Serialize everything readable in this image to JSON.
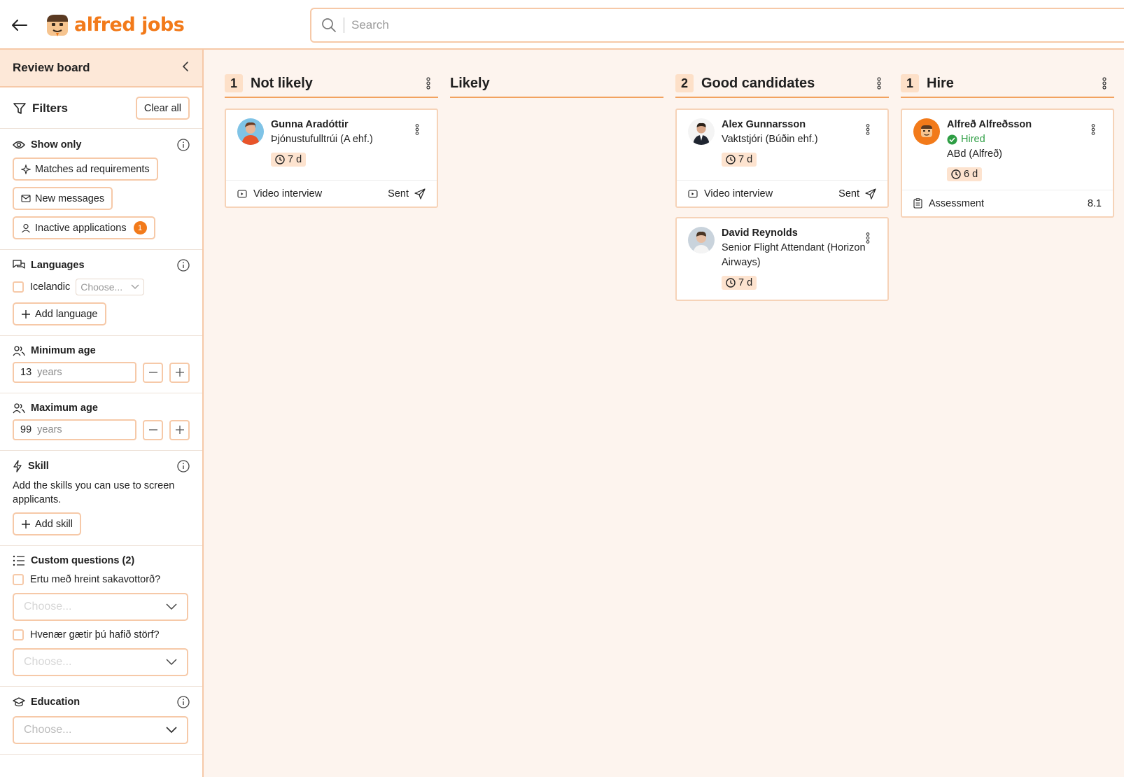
{
  "topbar": {
    "brand": "alfred jobs",
    "search_placeholder": "Search"
  },
  "sidebar": {
    "title": "Review board",
    "filters_label": "Filters",
    "clear_all": "Clear all",
    "show_only": {
      "title": "Show only",
      "chips": [
        {
          "label": "Matches ad requirements"
        },
        {
          "label": "New messages"
        },
        {
          "label": "Inactive applications",
          "badge": "1"
        }
      ]
    },
    "languages": {
      "title": "Languages",
      "items": [
        {
          "label": "Icelandic",
          "select_placeholder": "Choose..."
        }
      ],
      "add_label": "Add language"
    },
    "min_age": {
      "title": "Minimum age",
      "value": "13",
      "unit": "years"
    },
    "max_age": {
      "title": "Maximum age",
      "value": "99",
      "unit": "years"
    },
    "skill": {
      "title": "Skill",
      "help": "Add the skills you can use to screen applicants.",
      "add_label": "Add skill"
    },
    "custom_questions": {
      "title": "Custom questions (2)",
      "items": [
        {
          "question": "Ertu með hreint sakavottorð?",
          "placeholder": "Choose..."
        },
        {
          "question": "Hvenær gætir þú hafið störf?",
          "placeholder": "Choose..."
        }
      ]
    },
    "education": {
      "title": "Education",
      "placeholder": "Choose..."
    }
  },
  "board": {
    "columns": [
      {
        "count": "1",
        "title": "Not likely",
        "cards": [
          {
            "name": "Gunna Aradóttir",
            "role": "Þjónustufulltrúi (A ehf.)",
            "time": "7 d",
            "footer_left": "Video interview",
            "footer_right": "Sent"
          }
        ]
      },
      {
        "count": "",
        "title": "Likely",
        "cards": []
      },
      {
        "count": "2",
        "title": "Good candidates",
        "cards": [
          {
            "name": "Alex Gunnarsson",
            "role": "Vaktstjóri (Búðin ehf.)",
            "time": "7 d",
            "footer_left": "Video interview",
            "footer_right": "Sent"
          },
          {
            "name": "David Reynolds",
            "role": "Senior Flight Attendant (Horizon Airways)",
            "time": "7 d"
          }
        ]
      },
      {
        "count": "1",
        "title": "Hire",
        "cards": [
          {
            "name": "Alfreð Alfreðsson",
            "status": "Hired",
            "role": "ABd (Alfreð)",
            "time": "6 d",
            "footer_left": "Assessment",
            "footer_right": "8.1"
          }
        ]
      }
    ]
  },
  "colors": {
    "brand": "#f27a1a",
    "border": "#f6c9a8",
    "background": "#fdf4ee",
    "hired": "#2e9e44"
  }
}
